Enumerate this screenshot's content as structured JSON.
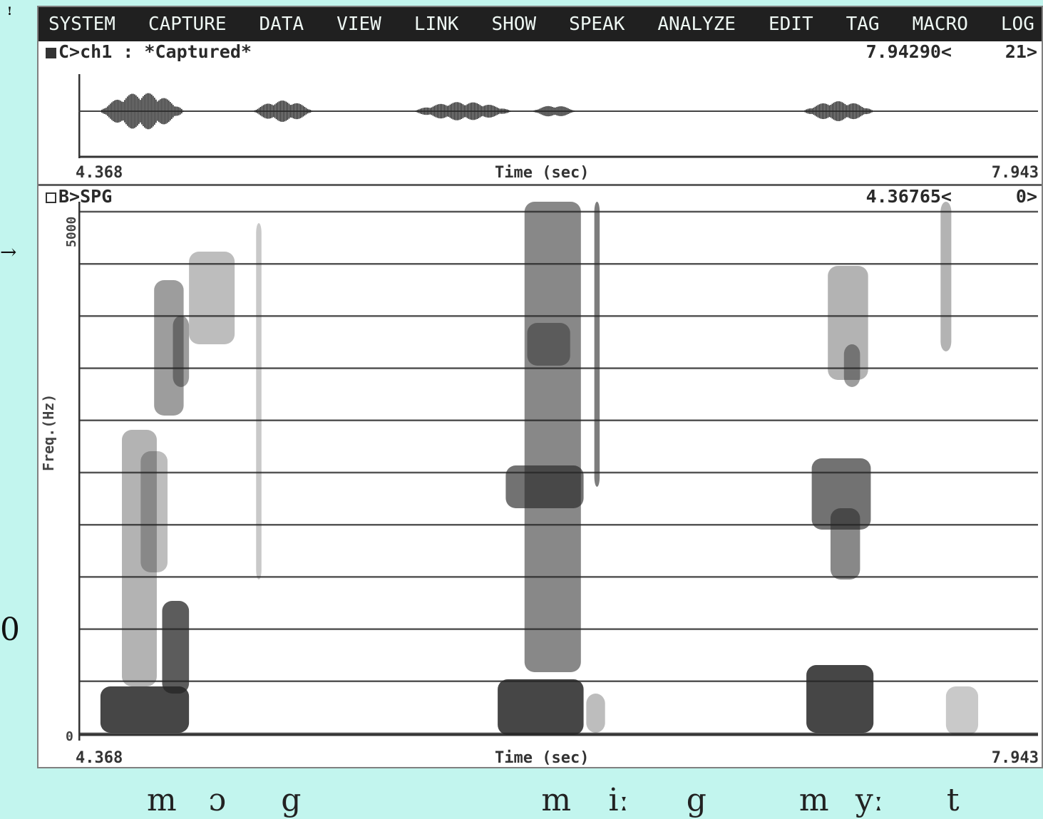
{
  "side": {
    "top": "!",
    "arrow": "→",
    "zero": "0"
  },
  "menu": [
    "SYSTEM",
    "CAPTURE",
    "DATA",
    "VIEW",
    "LINK",
    "SHOW",
    "SPEAK",
    "ANALYZE",
    "EDIT",
    "TAG",
    "MACRO",
    "LOG"
  ],
  "wave_panel": {
    "title": "C>ch1 : *Captured*",
    "cursor_value": "7.94290<",
    "right_value": "21>",
    "time_start": "4.368",
    "time_end": "7.943",
    "xlabel": "Time (sec)"
  },
  "spg_panel": {
    "title": "B>SPG",
    "cursor_value": "4.36765<",
    "right_value": "0>",
    "ylabel": "Freq.(Hz)",
    "y_top": "5000",
    "y_bottom": "0",
    "time_start": "4.368",
    "time_end": "7.943",
    "xlabel": "Time (sec)",
    "gridlines": 10
  },
  "phones": [
    {
      "text": "m",
      "time": 4.66
    },
    {
      "text": "ɔ",
      "time": 4.89
    },
    {
      "text": "g",
      "time": 5.16
    },
    {
      "text": "m",
      "time": 6.13
    },
    {
      "text": "iː",
      "time": 6.38
    },
    {
      "text": "g",
      "time": 6.67
    },
    {
      "text": "m",
      "time": 7.09
    },
    {
      "text": "yː",
      "time": 7.3
    },
    {
      "text": "t",
      "time": 7.64
    }
  ],
  "colors": {
    "background": "#c2f5ee",
    "menubar": "#202020",
    "ink": "#2a2a2a"
  }
}
